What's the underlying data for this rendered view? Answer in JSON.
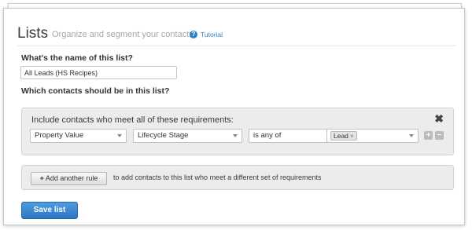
{
  "header": {
    "title": "Lists",
    "subtitle": "Organize and segment your contacts",
    "tutorial_label": "Tutorial",
    "help_glyph": "?"
  },
  "form": {
    "name_question": "What's the name of this list?",
    "name_value": "All Leads (HS Recipes)",
    "contacts_question": "Which contacts should be in this list?"
  },
  "requirements": {
    "heading": "Include contacts who meet all of these requirements:",
    "close_glyph": "✖",
    "filter_type": "Property Value",
    "property": "Lifecycle Stage",
    "operator": "is any of",
    "value_tag": "Lead",
    "tag_remove_glyph": "×",
    "add_glyph": "+",
    "remove_glyph": "−"
  },
  "rule": {
    "plus_glyph": "+",
    "add_rule_label": "Add another rule",
    "description": "to add contacts to this list who meet a different set of requirements"
  },
  "actions": {
    "save_label": "Save list"
  },
  "colors": {
    "accent": "#2d83c4",
    "save_button": "#3a88d0",
    "panel_bg": "#ececec"
  }
}
